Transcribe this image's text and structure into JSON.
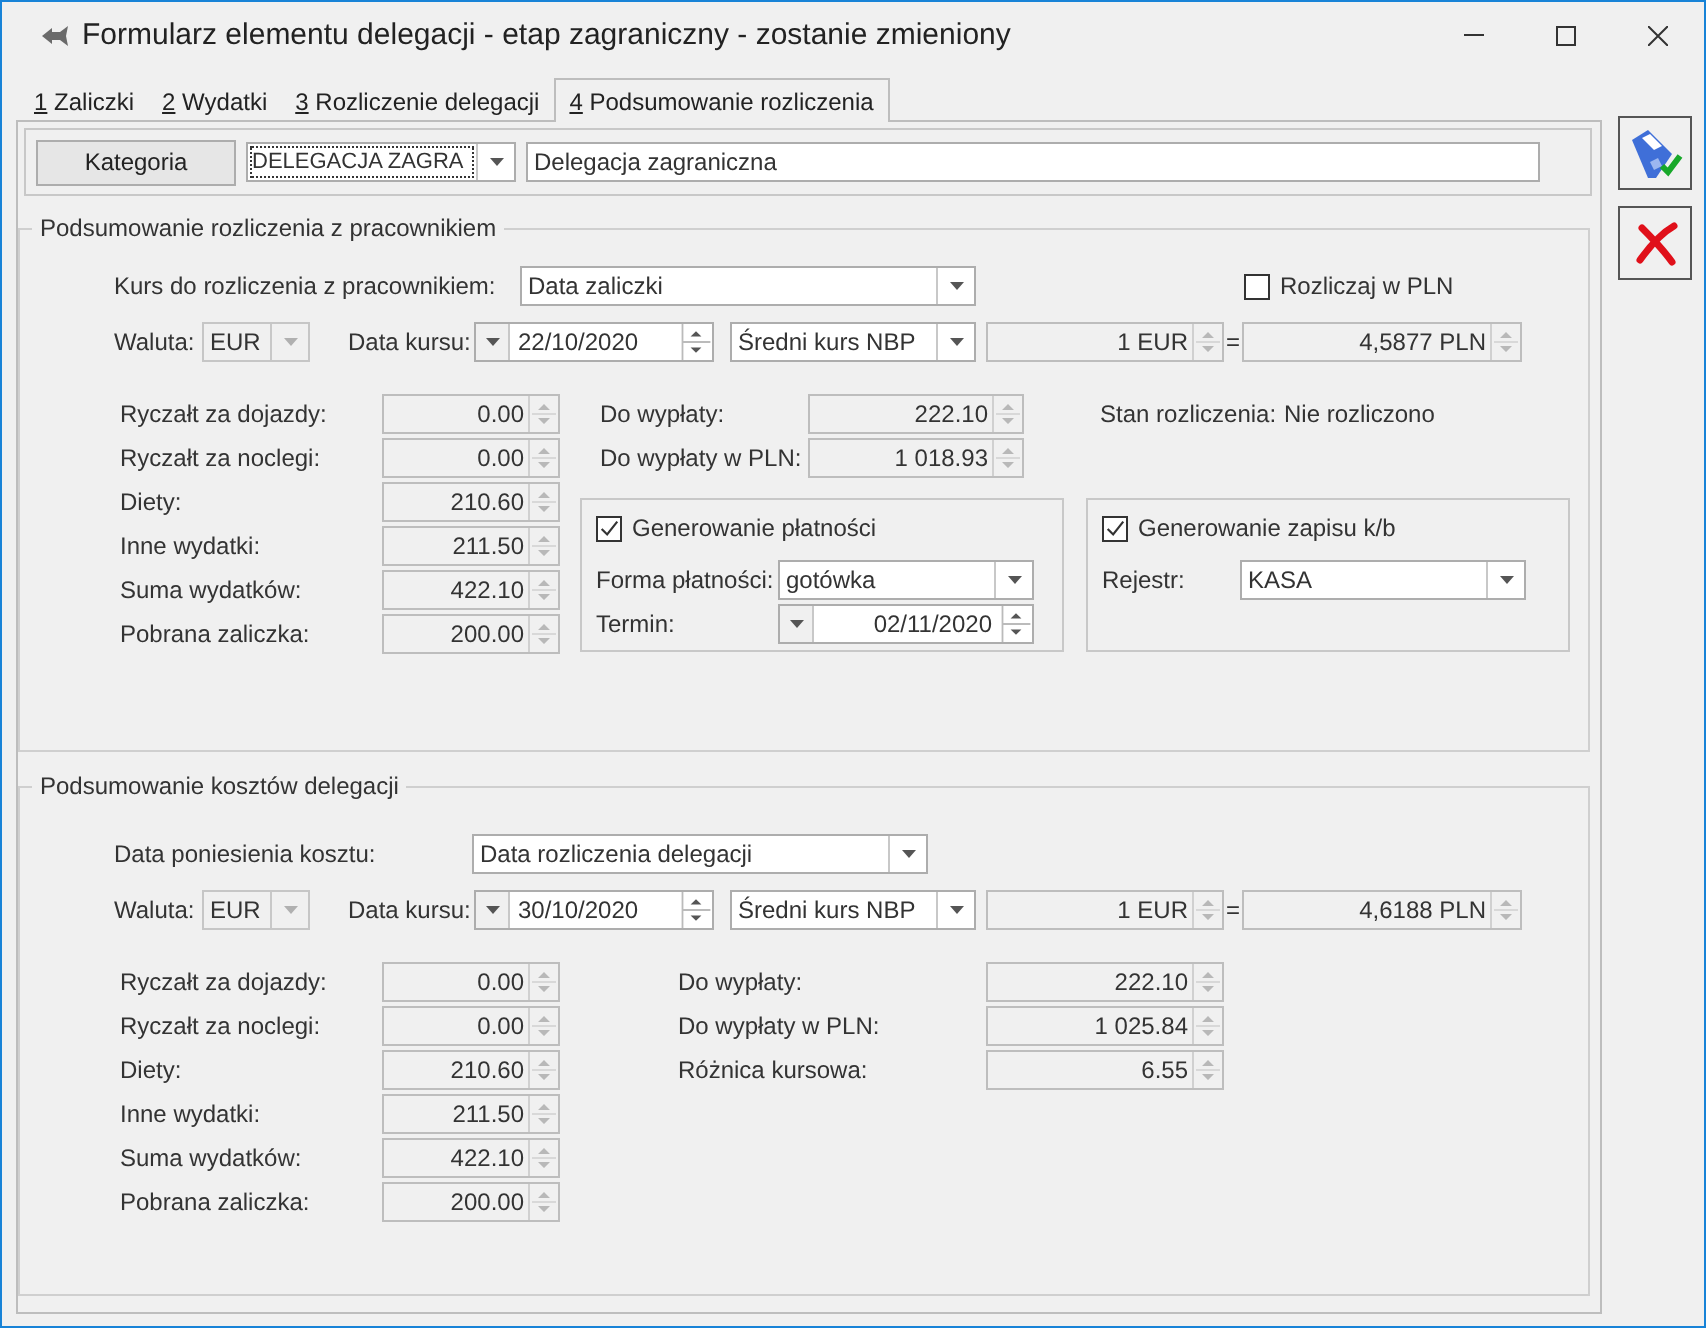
{
  "window": {
    "title": "Formularz elementu delegacji - etap zagraniczny - zostanie zmieniony"
  },
  "tabs": [
    {
      "hotkey": "1",
      "label": "Zaliczki",
      "selected": false
    },
    {
      "hotkey": "2",
      "label": "Wydatki",
      "selected": false
    },
    {
      "hotkey": "3",
      "label": "Rozliczenie delegacji",
      "selected": false
    },
    {
      "hotkey": "4",
      "label": "Podsumowanie rozliczenia",
      "selected": true
    }
  ],
  "category": {
    "button": "Kategoria",
    "code": "DELEGACJA ZAGRA",
    "name": "Delegacja zagraniczna"
  },
  "employee_settlement": {
    "title": "Podsumowanie rozliczenia z pracownikiem",
    "rate_basis": {
      "label": "Kurs do rozliczenia z pracownikiem:",
      "value": "Data zaliczki"
    },
    "settle_in_pln": {
      "label": "Rozliczaj w PLN",
      "checked": false
    },
    "exchange": {
      "currency_label": "Waluta:",
      "currency": "EUR",
      "date_label": "Data kursu:",
      "date": "22/10/2020",
      "rate_type": "Średni kurs NBP",
      "unit": "1 EUR",
      "equals": "=",
      "rate": "4,5877 PLN"
    },
    "amounts": [
      {
        "label": "Ryczałt za dojazdy:",
        "value": "0.00"
      },
      {
        "label": "Ryczałt za noclegi:",
        "value": "0.00"
      },
      {
        "label": "Diety:",
        "value": "210.60"
      },
      {
        "label": "Inne wydatki:",
        "value": "211.50"
      },
      {
        "label": "Suma wydatków:",
        "value": "422.10"
      },
      {
        "label": "Pobrana zaliczka:",
        "value": "200.00"
      }
    ],
    "payout": [
      {
        "label": "Do wypłaty:",
        "value": "222.10"
      },
      {
        "label": "Do wypłaty w PLN:",
        "value": "1 018.93"
      }
    ],
    "status": {
      "label": "Stan rozliczenia:",
      "value": "Nie rozliczono"
    },
    "payment": {
      "label": "Generowanie płatności",
      "checked": true,
      "method_label": "Forma płatności:",
      "method": "gotówka",
      "due_label": "Termin:",
      "due": "02/11/2020"
    },
    "cash_entry": {
      "label": "Generowanie zapisu k/b",
      "checked": true,
      "register_label": "Rejestr:",
      "register": "KASA"
    }
  },
  "cost_summary": {
    "title": "Podsumowanie kosztów delegacji",
    "cost_date": {
      "label": "Data poniesienia kosztu:",
      "value": "Data rozliczenia delegacji"
    },
    "exchange": {
      "currency_label": "Waluta:",
      "currency": "EUR",
      "date_label": "Data kursu:",
      "date": "30/10/2020",
      "rate_type": "Średni kurs NBP",
      "unit": "1 EUR",
      "equals": "=",
      "rate": "4,6188 PLN"
    },
    "amounts": [
      {
        "label": "Ryczałt za dojazdy:",
        "value": "0.00"
      },
      {
        "label": "Ryczałt za noclegi:",
        "value": "0.00"
      },
      {
        "label": "Diety:",
        "value": "210.60"
      },
      {
        "label": "Inne wydatki:",
        "value": "211.50"
      },
      {
        "label": "Suma wydatków:",
        "value": "422.10"
      },
      {
        "label": "Pobrana zaliczka:",
        "value": "200.00"
      }
    ],
    "payout": [
      {
        "label": "Do wypłaty:",
        "value": "222.10"
      },
      {
        "label": "Do wypłaty w PLN:",
        "value": "1 025.84"
      },
      {
        "label": "Różnica kursowa:",
        "value": "6.55"
      }
    ]
  }
}
